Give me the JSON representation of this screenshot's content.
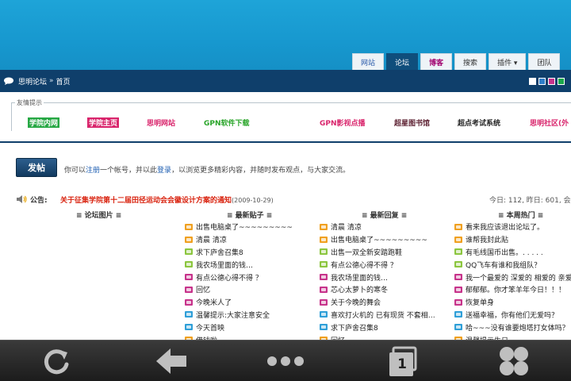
{
  "header": {
    "nav_tabs": [
      {
        "label": "网站",
        "style": "site"
      },
      {
        "label": "论坛",
        "style": "active"
      },
      {
        "label": "博客",
        "style": "blog"
      },
      {
        "label": "搜索",
        "style": ""
      },
      {
        "label": "插件 ▾",
        "style": ""
      },
      {
        "label": "团队",
        "style": ""
      }
    ]
  },
  "breadcrumb": {
    "forum": "思明论坛",
    "separator": "»",
    "current": "首页"
  },
  "style_colors": [
    "#ffffff",
    "#2f7ec9",
    "#c7338b",
    "#1aa84a"
  ],
  "friends": {
    "legend": "友情提示",
    "links": [
      {
        "label": "学院内网",
        "color": "#ffffff",
        "bg": "#27a844"
      },
      {
        "label": "学院主页",
        "color": "#ffffff",
        "bg": "#d9256c"
      },
      {
        "label": "思明网站",
        "color": "#d9256c",
        "bg": ""
      },
      {
        "label": "GPN软件下载",
        "color": "#2aa52a",
        "bg": ""
      },
      {
        "label": "GPN影视点播",
        "color": "#d9256c",
        "bg": ""
      },
      {
        "label": "超星图书馆",
        "color": "#5a1d2e",
        "bg": ""
      },
      {
        "label": "超点考试系统",
        "color": "#222222",
        "bg": ""
      },
      {
        "label": "思明社区(外",
        "color": "#d9256c",
        "bg": ""
      }
    ]
  },
  "post_button": "发帖",
  "register": {
    "prefix": "你可以",
    "register_link": "注册",
    "middle": "一个帐号，并以此",
    "login_link": "登录",
    "suffix": "，以浏览更多精彩内容，并随时发布观点，与大家交流。"
  },
  "notice": {
    "label": "公告:",
    "title": "关于征集学院第十二届田径运动会会徽设计方案的通知",
    "date": "(2009-10-29)",
    "stats": "今日: 112, 昨日: 601, 会员"
  },
  "columns": [
    {
      "header": "≡ 论坛图片 ≡",
      "items": []
    },
    {
      "header": "≡ 最新贴子 ≡",
      "items": [
        {
          "text": "出售电脑桌了~~~~~~~~~",
          "color": "#f0a020"
        },
        {
          "text": "清晨 清凉",
          "color": "#f0a020"
        },
        {
          "text": "求下庐舍召集8",
          "color": "#8cc63f"
        },
        {
          "text": "我农场里面的钱…",
          "color": "#8cc63f"
        },
        {
          "text": "有点公德心得不得 ？",
          "color": "#c7338b"
        },
        {
          "text": "回忆",
          "color": "#c7338b"
        },
        {
          "text": "今晚米人了",
          "color": "#c7338b"
        },
        {
          "text": "温馨提示:大家注意安全",
          "color": "#2f9fd8"
        },
        {
          "text": "今天首映",
          "color": "#2f9fd8"
        },
        {
          "text": "借钱啦",
          "color": "#f0a020"
        }
      ]
    },
    {
      "header": "≡ 最新回复 ≡",
      "items": [
        {
          "text": "清晨 清凉",
          "color": "#f0a020"
        },
        {
          "text": "出售电脑桌了~~~~~~~~~",
          "color": "#f0a020"
        },
        {
          "text": "出售一双全新安踏跑鞋",
          "color": "#8cc63f"
        },
        {
          "text": "有点公德心得不得 ？",
          "color": "#8cc63f"
        },
        {
          "text": "我农场里面的钱…",
          "color": "#c7338b"
        },
        {
          "text": "芯心太萝卜的寒冬",
          "color": "#c7338b"
        },
        {
          "text": "关于今晚的舞会",
          "color": "#c7338b"
        },
        {
          "text": "喜欢打火机的 已有现货 不套相…",
          "color": "#2f9fd8"
        },
        {
          "text": "求下庐舍召集8",
          "color": "#2f9fd8"
        },
        {
          "text": "回忆",
          "color": "#f0a020"
        }
      ]
    },
    {
      "header": "≡ 本周热门 ≡",
      "items": [
        {
          "text": "看来我应该退出论坛了。",
          "color": "#f0a020"
        },
        {
          "text": "谁帮我封此贴",
          "color": "#f0a020"
        },
        {
          "text": "有毛线国币出售。. . . . .",
          "color": "#8cc63f"
        },
        {
          "text": "QQ飞车有谁和我组队？",
          "color": "#8cc63f"
        },
        {
          "text": "我一个最爱的 深爱的 相爱的 亲爱",
          "color": "#c7338b"
        },
        {
          "text": "郁郁郁。你才笨羊年今日！！！",
          "color": "#c7338b"
        },
        {
          "text": "恢复单身",
          "color": "#c7338b"
        },
        {
          "text": "送福幸福，你有他们无爱吗？",
          "color": "#2f9fd8"
        },
        {
          "text": "哈~~~没有谁要炮塔打女体吗？",
          "color": "#2f9fd8"
        },
        {
          "text": "温馨提示生日一",
          "color": "#f0a020"
        }
      ]
    }
  ],
  "toolbar": {
    "tab_count": "1",
    "icons": [
      "refresh-icon",
      "back-arrow-icon",
      "more-dots-icon",
      "tabs-icon",
      "menu-grid-icon"
    ]
  }
}
